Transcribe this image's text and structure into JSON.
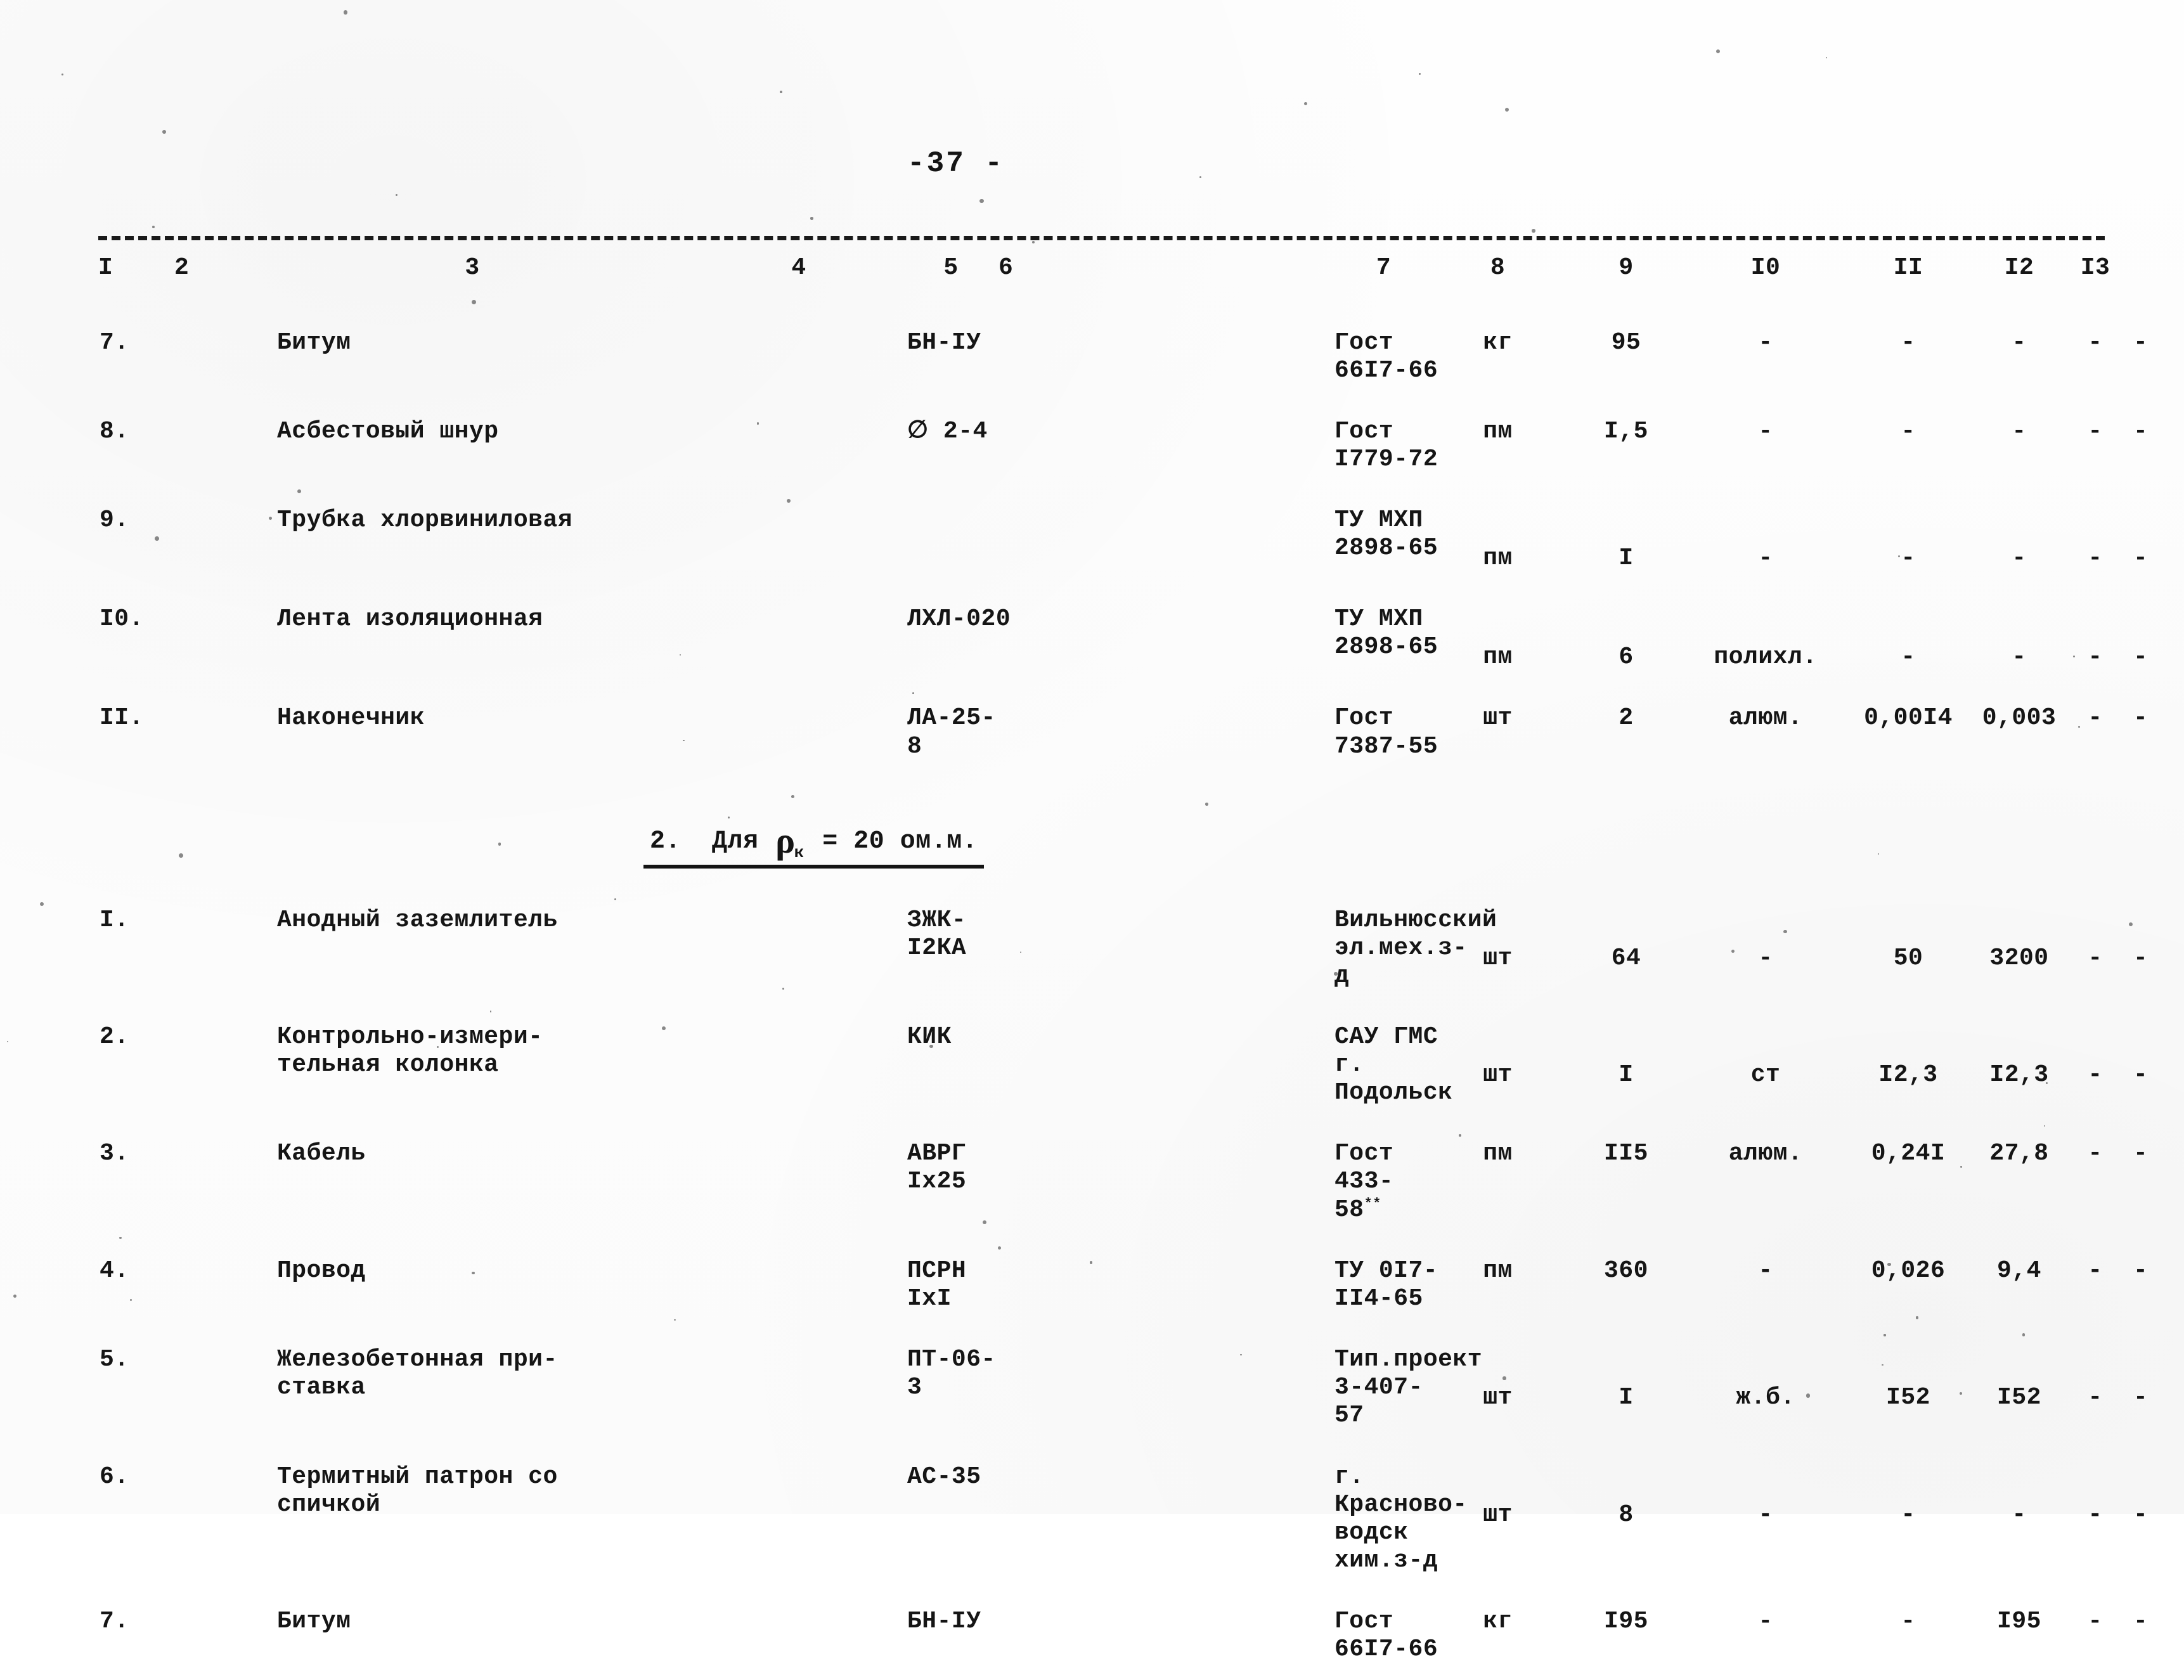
{
  "document": {
    "page_number": "-37 -",
    "language": "ru"
  },
  "table": {
    "column_headers": [
      "I",
      "2",
      "3",
      "4",
      "5",
      "6",
      "7",
      "8",
      "9",
      "I0",
      "II",
      "I2",
      "I3"
    ],
    "sections": [
      {
        "heading": null,
        "rows": [
          {
            "num": "7.",
            "name": "Битум",
            "name_line2": "",
            "mark": "БН-IУ",
            "doc": "Гост 66I7-66",
            "doc_line2": "",
            "unit": "кг",
            "qty": "95",
            "material": "-",
            "weight_unit": "-",
            "weight_total": "-",
            "col12": "-",
            "col13": "-"
          },
          {
            "num": "8.",
            "name": "Асбестовый шнур",
            "name_line2": "",
            "mark": "∅ 2-4",
            "doc": "Гост I779-72",
            "doc_line2": "",
            "unit": "пм",
            "qty": "I,5",
            "material": "-",
            "weight_unit": "-",
            "weight_total": "-",
            "col12": "-",
            "col13": "-"
          },
          {
            "num": "9.",
            "name": "Трубка хлорвиниловая",
            "name_line2": "",
            "mark": "",
            "doc": "ТУ МХП",
            "doc_line2": "2898-65",
            "unit": "пм",
            "qty": "I",
            "material": "-",
            "weight_unit": "-",
            "weight_total": "-",
            "col12": "-",
            "col13": "-"
          },
          {
            "num": "I0.",
            "name": "Лента изоляционная",
            "name_line2": "",
            "mark": "ЛХЛ-020",
            "doc": "ТУ МХП",
            "doc_line2": "2898-65",
            "unit": "пм",
            "qty": "6",
            "material": "полихл.",
            "weight_unit": "-",
            "weight_total": "-",
            "col12": "-",
            "col13": "-"
          },
          {
            "num": "II.",
            "name": "Наконечник",
            "name_line2": "",
            "mark": "ЛА-25-8",
            "doc": "Гост 7387-55",
            "doc_line2": "",
            "unit": "шт",
            "qty": "2",
            "material": "алюм.",
            "weight_unit": "0,00I4",
            "weight_total": "0,003",
            "col12": "-",
            "col13": "-"
          }
        ]
      },
      {
        "heading": {
          "number": "2.",
          "text_before": "Для",
          "symbol": "ρ",
          "subscript": "к",
          "text_after": "= 20 ом.м."
        },
        "rows": [
          {
            "num": "I.",
            "name": "Анодный заземлитель",
            "name_line2": "",
            "mark": "ЗЖК-I2КА",
            "doc": "Вильнюсский",
            "doc_line2": "эл.мех.з-д",
            "unit": "шт",
            "qty": "64",
            "material": "-",
            "weight_unit": "50",
            "weight_total": "3200",
            "col12": "-",
            "col13": "-"
          },
          {
            "num": "2.",
            "name": "Контрольно-измери-",
            "name_line2": "тельная колонка",
            "mark": "КИК",
            "doc": "САУ ГМС г.",
            "doc_line2": "Подольск",
            "unit": "шт",
            "qty": "I",
            "material": "ст",
            "weight_unit": "I2,3",
            "weight_total": "I2,3",
            "col12": "-",
            "col13": "-"
          },
          {
            "num": "3.",
            "name": "Кабель",
            "name_line2": "",
            "mark": "АВРГ Iх25",
            "doc": "Гост 433-58",
            "doc_sup": "**",
            "doc_line2": "",
            "unit": "пм",
            "qty": "II5",
            "material": "алюм.",
            "weight_unit": "0,24I",
            "weight_total": "27,8",
            "col12": "-",
            "col13": "-"
          },
          {
            "num": "4.",
            "name": "Провод",
            "name_line2": "",
            "mark": "ПСРН IхI",
            "doc": "ТУ 0I7-II4-65",
            "doc_line2": "",
            "unit": "пм",
            "qty": "360",
            "material": "-",
            "weight_unit": "0,026",
            "weight_total": "9,4",
            "col12": "-",
            "col13": "-"
          },
          {
            "num": "5.",
            "name": "Железобетонная при-",
            "name_line2": "ставка",
            "mark": "ПТ-06-3",
            "doc": "Тип.проект",
            "doc_line2": "3-407-57",
            "unit": "шт",
            "qty": "I",
            "material": "ж.б.",
            "weight_unit": "I52",
            "weight_total": "I52",
            "col12": "-",
            "col13": "-"
          },
          {
            "num": "6.",
            "name": "Термитный патрон со",
            "name_line2": "спичкой",
            "mark": "АС-35",
            "doc": "г. Красново-",
            "doc_line2": "водск хим.з-д",
            "unit": "шт",
            "qty": "8",
            "material": "-",
            "weight_unit": "-",
            "weight_total": "-",
            "col12": "-",
            "col13": "-"
          },
          {
            "num": "7.",
            "name": "Битум",
            "name_line2": "",
            "mark": "БН-IУ",
            "doc": "Гост 66I7-66",
            "doc_line2": "",
            "unit": "кг",
            "qty": "I95",
            "material": "-",
            "weight_unit": "-",
            "weight_total": "I95",
            "col12": "-",
            "col13": "-"
          }
        ]
      }
    ]
  }
}
